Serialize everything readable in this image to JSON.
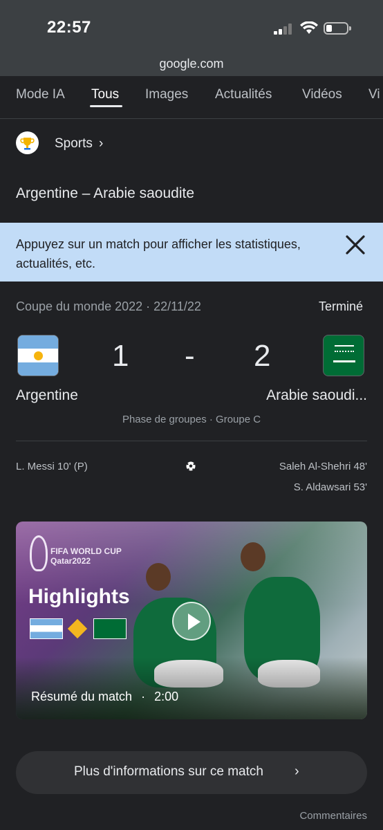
{
  "status_bar": {
    "time": "22:57",
    "battery_level": 0.25
  },
  "browser": {
    "url": "google.com"
  },
  "tabs": [
    {
      "label": "Mode IA"
    },
    {
      "label": "Tous",
      "active": true
    },
    {
      "label": "Images"
    },
    {
      "label": "Actualités"
    },
    {
      "label": "Vidéos"
    },
    {
      "label": "Vi"
    }
  ],
  "breadcrumb": {
    "label": "Sports",
    "chevron": "›",
    "icon": "trophy-icon"
  },
  "match_title": "Argentine – Arabie saoudite",
  "banner": {
    "text": "Appuyez sur un match pour afficher les statistiques, actualités, etc.",
    "close_icon": "close-icon",
    "bg_color": "#c2dcf7"
  },
  "match": {
    "competition": "Coupe du monde 2022 · 22/11/22",
    "status": "Terminé",
    "home": {
      "name": "Argentine",
      "score": "1",
      "flag": "argentina-flag-icon"
    },
    "away": {
      "name": "Arabie saoudi...",
      "score": "2",
      "flag": "saudi-arabia-flag-icon"
    },
    "dash": "-",
    "phase": "Phase de groupes · Groupe C",
    "home_goals": [
      "L. Messi 10' (P)"
    ],
    "away_goals": [
      "Saleh Al-Shehri 48'",
      "S. Aldawsari 53'"
    ]
  },
  "highlights": {
    "brand": "FIFA WORLD CUP",
    "brand_sub": "Qatar2022",
    "title": "Highlights",
    "caption": "Résumé du match",
    "separator": "·",
    "duration": "2:00"
  },
  "more_button": {
    "label": "Plus d'informations sur ce match",
    "chevron": "›"
  },
  "feedback": "Commentaires"
}
